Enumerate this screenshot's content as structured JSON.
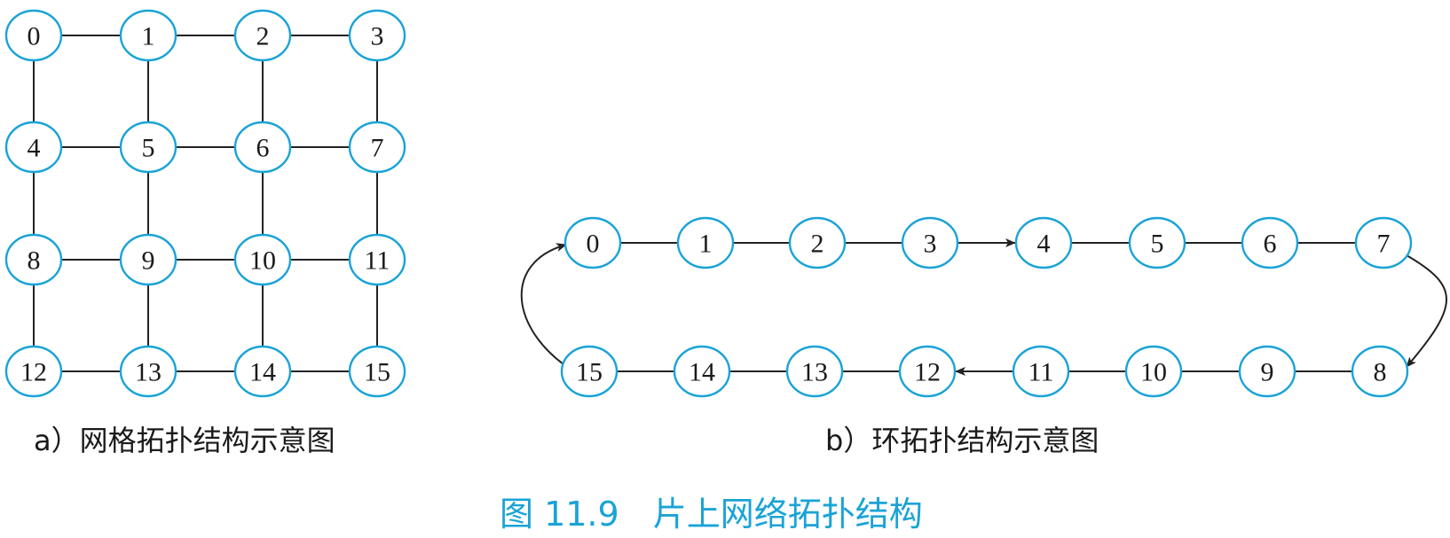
{
  "diagram_a": {
    "caption": "a）网格拓扑结构示意图",
    "nodes": [
      "0",
      "1",
      "2",
      "3",
      "4",
      "5",
      "6",
      "7",
      "8",
      "9",
      "10",
      "11",
      "12",
      "13",
      "14",
      "15"
    ],
    "edges": [
      [
        0,
        1
      ],
      [
        1,
        2
      ],
      [
        2,
        3
      ],
      [
        4,
        5
      ],
      [
        5,
        6
      ],
      [
        6,
        7
      ],
      [
        8,
        9
      ],
      [
        9,
        10
      ],
      [
        10,
        11
      ],
      [
        12,
        13
      ],
      [
        13,
        14
      ],
      [
        14,
        15
      ],
      [
        0,
        4
      ],
      [
        4,
        8
      ],
      [
        8,
        12
      ],
      [
        1,
        5
      ],
      [
        5,
        9
      ],
      [
        9,
        13
      ],
      [
        2,
        6
      ],
      [
        6,
        10
      ],
      [
        10,
        14
      ],
      [
        3,
        7
      ],
      [
        7,
        11
      ],
      [
        11,
        15
      ]
    ]
  },
  "diagram_b": {
    "caption": "b）环拓扑结构示意图",
    "top_row": [
      "0",
      "1",
      "2",
      "3",
      "4",
      "5",
      "6",
      "7"
    ],
    "bottom_row": [
      "15",
      "14",
      "13",
      "12",
      "11",
      "10",
      "9",
      "8"
    ],
    "arrow_edges": [
      [
        "3",
        "4"
      ],
      [
        "7",
        "8"
      ],
      [
        "11",
        "12"
      ],
      [
        "15",
        "0"
      ]
    ]
  },
  "figure": {
    "title": "图 11.9　片上网络拓扑结构"
  },
  "colors": {
    "node_stroke": "#1aa3d6",
    "title": "#1aa3d6",
    "edge": "#222222"
  }
}
